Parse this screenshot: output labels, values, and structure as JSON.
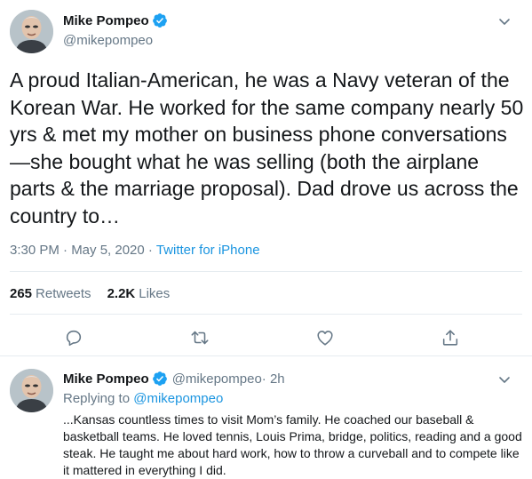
{
  "main_tweet": {
    "display_name": "Mike Pompeo",
    "handle": "@mikepompeo",
    "text": "A proud Italian-American, he was a Navy veteran of the Korean War. He worked for the same company nearly 50 yrs & met my mother on business phone conversations—she bought what he was selling (both the airplane parts & the marriage proposal). Dad drove us across the country to…",
    "timestamp": "3:30 PM · May 5, 2020",
    "separator": " · ",
    "source": "Twitter for iPhone",
    "retweets_count": "265",
    "retweets_label": "Retweets",
    "likes_count": "2.2K",
    "likes_label": "Likes",
    "icons": [
      "reply-icon",
      "retweet-icon",
      "like-icon",
      "share-icon"
    ]
  },
  "reply_tweet": {
    "display_name": "Mike Pompeo",
    "handle": "@mikepompeo",
    "time": " · 2h",
    "replying_prefix": "Replying to ",
    "replying_to": "@mikepompeo",
    "text": "...Kansas countless times to visit Mom’s family. He coached our baseball & basketball teams. He loved tennis, Louis Prima, bridge, politics, reading and a good steak. He taught me about hard work, how to throw a curveball and to compete like it mattered in everything I did."
  },
  "colors": {
    "text": "#14171a",
    "secondary": "#657786",
    "link": "#1b95e0",
    "verified": "#1da1f2",
    "divider": "#e6ecf0"
  }
}
